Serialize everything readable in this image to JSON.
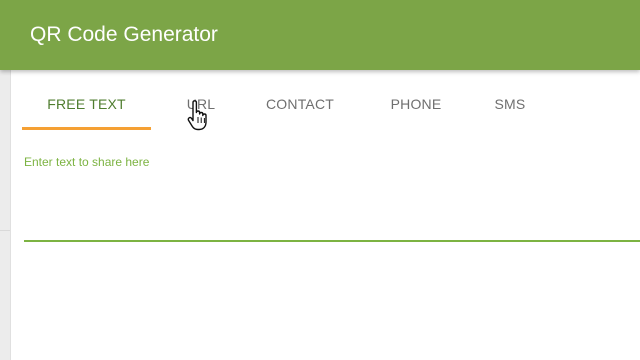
{
  "app": {
    "title": "QR Code Generator",
    "brand_color": "#7ca547"
  },
  "tabs": [
    {
      "label": "FREE TEXT",
      "active": true
    },
    {
      "label": "URL",
      "active": false
    },
    {
      "label": "CONTACT",
      "active": false
    },
    {
      "label": "PHONE",
      "active": false
    },
    {
      "label": "SMS",
      "active": false
    }
  ],
  "indicator_color": "#f5a033",
  "form": {
    "text_label": "Enter text to share here",
    "text_value": "",
    "accent_color": "#7cb342"
  },
  "pointer": {
    "icon": "hand-pointer-icon"
  }
}
